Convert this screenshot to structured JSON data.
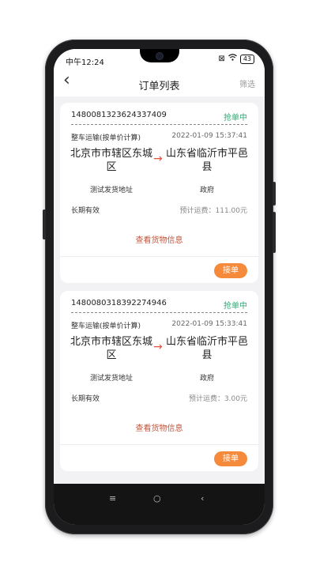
{
  "status_bar": {
    "time": "中午12:24",
    "battery": "43",
    "icons": [
      "close-box-icon",
      "wifi-icon",
      "battery-icon"
    ]
  },
  "header": {
    "back_icon": "chevron-left-icon",
    "title": "订单列表",
    "filter_label": "筛选"
  },
  "orders": [
    {
      "id": "1480081323624337409",
      "status": "抢单中",
      "type": "整车运输(按单价计算)",
      "date": "2022-01-09 15:37:41",
      "from_city": "北京市市辖区东城区",
      "to_city": "山东省临沂市平邑县",
      "from_address": "测试发货地址",
      "to_address": "政府",
      "validity": "长期有效",
      "fee": "预计运费：111.00元",
      "cargo_link": "查看货物信息",
      "accept_label": "接单"
    },
    {
      "id": "1480080318392274946",
      "status": "抢单中",
      "type": "整车运输(按单价计算)",
      "date": "2022-01-09 15:33:41",
      "from_city": "北京市市辖区东城区",
      "to_city": "山东省临沂市平邑县",
      "from_address": "测试发货地址",
      "to_address": "政府",
      "validity": "长期有效",
      "fee": "预计运费：3.00元",
      "cargo_link": "查看货物信息",
      "accept_label": "接单"
    }
  ],
  "system_nav": {
    "menu": "≡",
    "home": "○",
    "back": "‹"
  },
  "colors": {
    "status_green": "#2daa73",
    "accent_orange": "#f58a3c",
    "arrow_red": "#e0533d",
    "link_red": "#c0573f"
  }
}
